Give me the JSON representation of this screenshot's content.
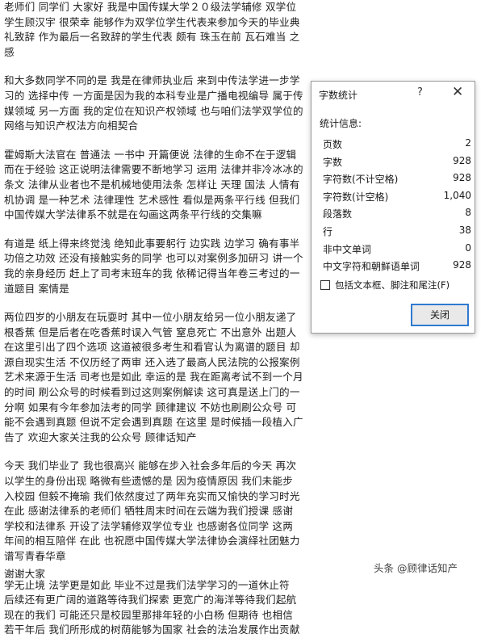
{
  "document": {
    "paragraphs": [
      "老师们 同学们 大家好 我是中国传媒大学２０级法学辅修 双学位学生顾汉宇 很荣幸 能够作为双学位学生代表来参加今天的毕业典礼致辞 作为最后一名致辞的学生代表 颇有 珠玉在前 瓦石难当 之感",
      "和大多数同学不同的是 我是在律师执业后 来到中传法学进一步学习的 选择中传 一方面是因为我的本科专业是广播电视编导 属于传媒领域 另一方面 我的定位在知识产权领域 也与咱们法学双学位的网络与知识产权法方向相契合",
      "霍姆斯大法官在 普通法 一书中 开篇便说 法律的生命不在于逻辑而在于经验 这正说明法律需要不断地学习 运用 法律并非冷冰冰的条文 法律从业者也不是机械地使用法条 怎样让 天理 国法 人情有机协调 是一种艺术 法律理性 艺术感性 看似是两条平行线 但我们中国传媒大学法律系不就是在勾画这两条平行线的交集嘛",
      "有道是 纸上得来终觉浅 绝知此事要躬行 边实践 边学习 确有事半功倍之功效 还没有接触实务的同学 也可以对案例多加研习 讲一个我的亲身经历 赶上了司考末班车的我 依稀记得当年卷三考过的一道题目 案情是",
      "两位四岁的小朋友在玩耍时 其中一位小朋友给另一位小朋友递了根香蕉 但是后者在吃香蕉时误入气管 窒息死亡 不出意外 出题人在这里引出了四个选项 这道被很多考生和看官认为离谱的题目 却源自现实生活 不仅历经了两审 还入选了最高人民法院的公报案例 艺术来源于生活 司考也是如此 幸运的是 我在距离考试不到一个月的时间 刷公众号的时候看到过这则案例解读 这可真是送上门的一分啊 如果有今年参加法考的同学 顾律建议 不妨也刷刷公众号 可能不会遇到真题 但说不定会遇到真题 在这里 是时候插一段植入广告了 欢迎大家关注我的公众号 顾律话知产",
      "今天 我们毕业了 我也很高兴 能够在步入社会多年后的今天 再次以学生的身份出现 略微有些遗憾的是 因为疫情原因 我们未能步入校园 但毅不掩瑜 我们依然度过了两年充实而又愉快的学习时光 在此 感谢法律系的老师们 牺牲周末时间在云端为我们授课 感谢学校和法律系 开设了法学辅修双学位专业 也感谢各位同学 这两年间的相互陪伴 在此 也祝愿中国传媒大学法律协会演绎社团魅力 谱写青春华章",
      "学无止境 法学更是如此 毕业不过是我们法学学习的一道休止符 后续还有更广阔的道路等待我们探索 更宽广的海洋等待我们起航 现在的我们 可能还只是校园里那排年轻的小白杨 但期待 也相信若干年后 我们所形成的树荫能够为国家 社会的法治发展作出贡献"
    ],
    "closing": "谢谢大家"
  },
  "dialog": {
    "title": "字数统计",
    "help": "?",
    "close": "✕",
    "section_label": "统计信息:",
    "rows": [
      {
        "label": "页数",
        "value": "2"
      },
      {
        "label": "字数",
        "value": "928"
      },
      {
        "label": "字符数(不计空格)",
        "value": "928"
      },
      {
        "label": "字符数(计空格)",
        "value": "1,040"
      },
      {
        "label": "段落数",
        "value": "8"
      },
      {
        "label": "行",
        "value": "38"
      },
      {
        "label": "非中文单词",
        "value": "0"
      },
      {
        "label": "中文字符和朝鲜语单词",
        "value": "928"
      }
    ],
    "checkbox_label": "包括文本框、脚注和尾注(F)",
    "close_button": "关闭"
  },
  "watermark": "头条 @顾律话知产"
}
